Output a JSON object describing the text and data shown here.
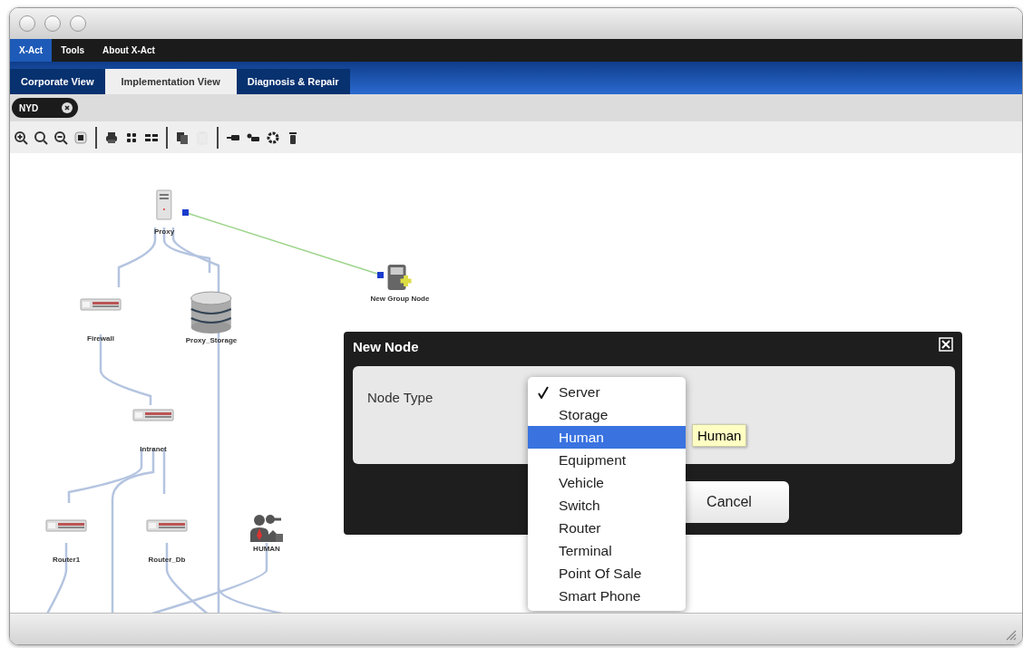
{
  "menu": [
    {
      "label": "X-Act",
      "selected": true
    },
    {
      "label": "Tools",
      "selected": false
    },
    {
      "label": "About X-Act",
      "selected": false
    }
  ],
  "tabs": [
    {
      "label": "Corporate View",
      "selected": false
    },
    {
      "label": "Implementation View",
      "selected": true
    },
    {
      "label": "Diagnosis & Repair",
      "selected": false
    }
  ],
  "filter": {
    "label": "NYD"
  },
  "toolbar": [
    [
      {
        "kind": "zoom-in",
        "disabled": false
      },
      {
        "kind": "zoom",
        "disabled": false
      },
      {
        "kind": "zoom-out",
        "disabled": false
      },
      {
        "kind": "fit",
        "disabled": false
      }
    ],
    [
      {
        "kind": "print",
        "disabled": false
      },
      {
        "kind": "grid",
        "disabled": false
      },
      {
        "kind": "rows",
        "disabled": false
      }
    ],
    [
      {
        "kind": "copy",
        "disabled": false
      },
      {
        "kind": "paste",
        "disabled": true
      }
    ],
    [
      {
        "kind": "link-left",
        "disabled": false
      },
      {
        "kind": "link-right",
        "disabled": false
      },
      {
        "kind": "gear",
        "disabled": false
      },
      {
        "kind": "trash",
        "disabled": false
      }
    ]
  ],
  "nodes": [
    {
      "kind": "server",
      "label": "Proxy"
    },
    {
      "kind": "switch",
      "label": "Firewall"
    },
    {
      "kind": "storage",
      "label": "Proxy_Storage"
    },
    {
      "kind": "group",
      "label": "New Group Node"
    },
    {
      "kind": "switch",
      "label": "Intranet"
    },
    {
      "kind": "switch",
      "label": "Router1"
    },
    {
      "kind": "switch",
      "label": "Router_Db"
    },
    {
      "kind": "human",
      "label": "HUMAN"
    }
  ],
  "dialog": {
    "title": "New Node",
    "field_label": "Node Type",
    "buttons": [
      {
        "label": "Cancel"
      }
    ],
    "options": [
      {
        "label": "Server",
        "checked": true,
        "selected": false
      },
      {
        "label": "Storage",
        "checked": false,
        "selected": false
      },
      {
        "label": "Human",
        "checked": false,
        "selected": true
      },
      {
        "label": "Equipment",
        "checked": false,
        "selected": false
      },
      {
        "label": "Vehicle",
        "checked": false,
        "selected": false
      },
      {
        "label": "Switch",
        "checked": false,
        "selected": false
      },
      {
        "label": "Router",
        "checked": false,
        "selected": false
      },
      {
        "label": "Terminal",
        "checked": false,
        "selected": false
      },
      {
        "label": "Point Of Sale",
        "checked": false,
        "selected": false
      },
      {
        "label": "Smart Phone",
        "checked": false,
        "selected": false
      }
    ],
    "tooltip": "Human"
  }
}
